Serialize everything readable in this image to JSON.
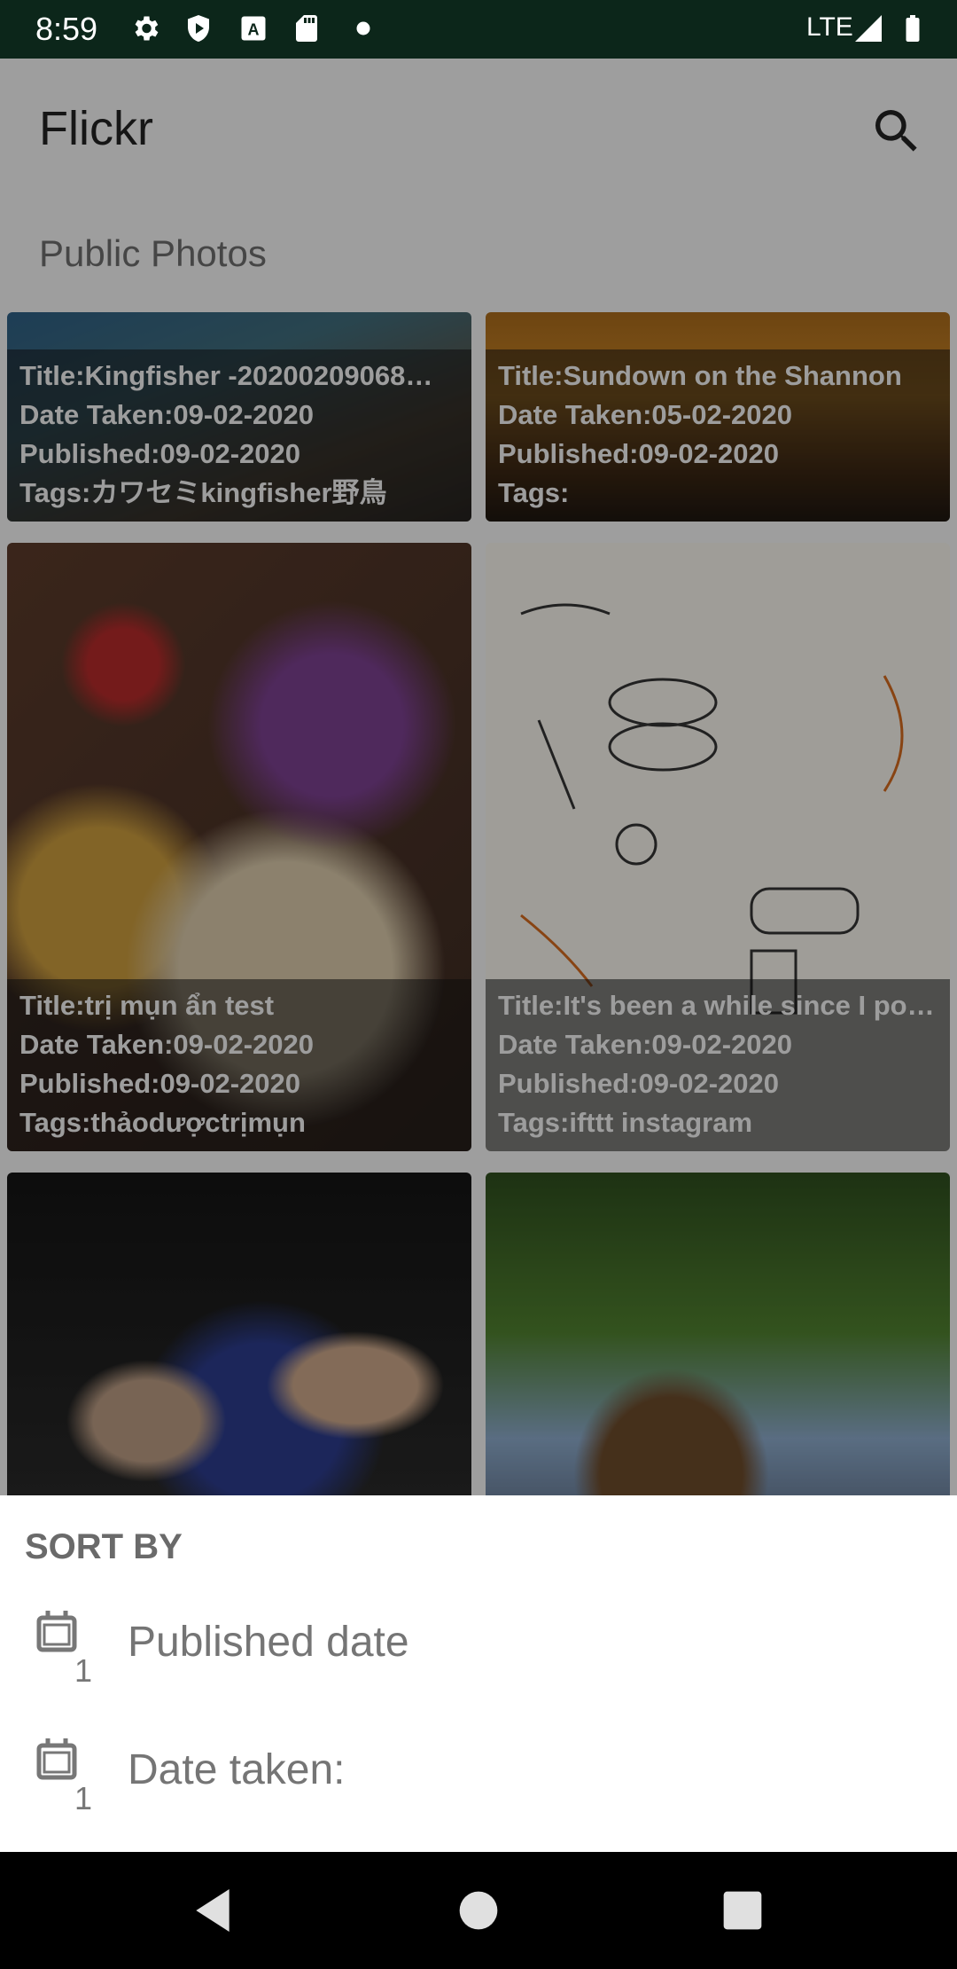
{
  "status_bar": {
    "time": "8:59",
    "network": "LTE",
    "icons": [
      "settings-icon",
      "shield-play-icon",
      "font-download-icon",
      "sd-card-icon",
      "notification-dot-icon",
      "signal-icon",
      "battery-icon"
    ]
  },
  "app_bar": {
    "title": "Flickr",
    "subtitle": "Public Photos",
    "search_icon": "search-icon"
  },
  "photos": [
    {
      "title": "Title:Kingfisher -20200209068…",
      "date_taken": "Date Taken:09-02-2020",
      "published": "Published:09-02-2020",
      "tags": "Tags:カワセミkingfisher野鳥"
    },
    {
      "title": "Title:Sundown on the Shannon",
      "date_taken": "Date Taken:05-02-2020",
      "published": "Published:09-02-2020",
      "tags": "Tags:"
    },
    {
      "title": "Title:trị mụn ẩn test",
      "date_taken": "Date Taken:09-02-2020",
      "published": "Published:09-02-2020",
      "tags": "Tags:thảodượctrịmụn"
    },
    {
      "title": "Title:It's been a while since I po…",
      "date_taken": "Date Taken:09-02-2020",
      "published": "Published:09-02-2020",
      "tags": "Tags:ifttt instagram"
    }
  ],
  "sort_sheet": {
    "title": "SORT BY",
    "options": [
      {
        "label": "Published date",
        "icon": "calendar-sort-icon"
      },
      {
        "label": "Date taken:",
        "icon": "calendar-sort-icon"
      }
    ]
  },
  "nav_bar": {
    "back_icon": "back-triangle-icon",
    "home_icon": "home-circle-icon",
    "recents_icon": "recents-square-icon"
  },
  "colors": {
    "status_bar": "#0c261a",
    "sheet_background": "#ffffff",
    "sheet_text": "#757575"
  }
}
